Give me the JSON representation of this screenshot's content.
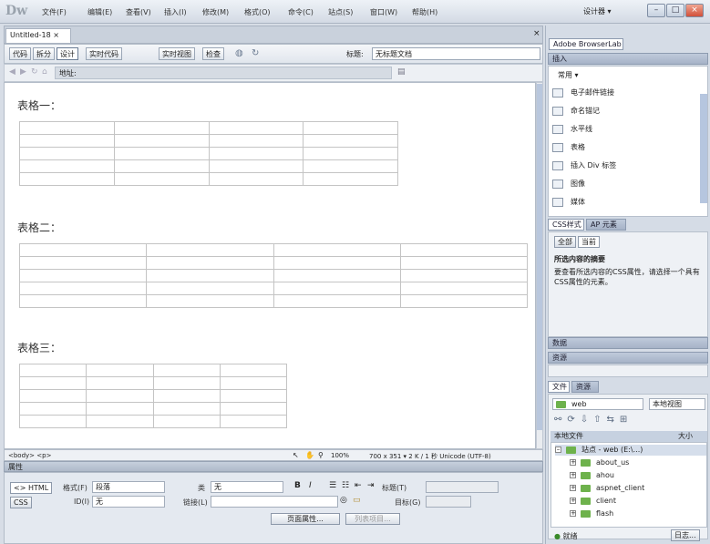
{
  "app": {
    "logo": "Dw",
    "menus": [
      "文件(F)",
      "编辑(E)",
      "查看(V)",
      "插入(I)",
      "修改(M)",
      "格式(O)",
      "命令(C)",
      "站点(S)",
      "窗口(W)",
      "帮助(H)"
    ],
    "workspace": "设计器 ▾"
  },
  "document": {
    "tab_label": "Untitled-18 ×",
    "view_buttons": [
      "代码",
      "拆分",
      "设计",
      "实时代码",
      "实时视图",
      "检查"
    ],
    "title_label": "标题:",
    "title_value": "无标题文档",
    "address": "地址:"
  },
  "canvas": {
    "tables": [
      {
        "heading": "表格一：",
        "rows": 5,
        "cols": 4
      },
      {
        "heading": "表格二：",
        "rows": 5,
        "cols": 4
      },
      {
        "heading": "表格三：",
        "rows": 5,
        "cols": 4
      }
    ]
  },
  "status": {
    "tag": "<body> <p>",
    "zoom": "100%",
    "size_info": "700 x 351 ▾ 2 K / 1 秒  Unicode (UTF-8)"
  },
  "properties": {
    "panel_title": "属性",
    "html_label": "<> HTML",
    "css_label": "CSS",
    "format_label": "格式(F)",
    "format_value": "段落",
    "class_label": "类",
    "class_value": "无",
    "id_label": "ID(I)",
    "id_value": "无",
    "link_label": "链接(L)",
    "title_label": "标题(T)",
    "target_label": "目标(G)",
    "page_props_button": "页面属性...",
    "list_button": "列表项目..."
  },
  "right_panel": {
    "browserlab_tab": "Adobe BrowserLab",
    "insert_header": "插入",
    "insert_category": "常用 ▾",
    "insert_items": [
      "电子邮件链接",
      "命名锚记",
      "水平线",
      "表格",
      "插入 Div 标签",
      "图像",
      "媒体"
    ],
    "css_tabs": [
      "CSS样式",
      "AP 元素"
    ],
    "css_subtabs": [
      "全部",
      "当前"
    ],
    "css_heading": "所选内容的摘要",
    "css_message": "要查看所选内容的CSS属性，请选择一个具有CSS属性的元素。",
    "business_header": "数据",
    "assets_header": "资源",
    "files_tabs": [
      "文件",
      "资源"
    ],
    "site_name": "web",
    "view_name": "本地视图",
    "files_header": "本地文件",
    "files_size": "大小",
    "root_label": "站点 - web (E:\\...)",
    "files": [
      "about_us",
      "ahou",
      "aspnet_client",
      "client",
      "flash"
    ],
    "footer_label": "就绪",
    "log_button": "日志..."
  }
}
